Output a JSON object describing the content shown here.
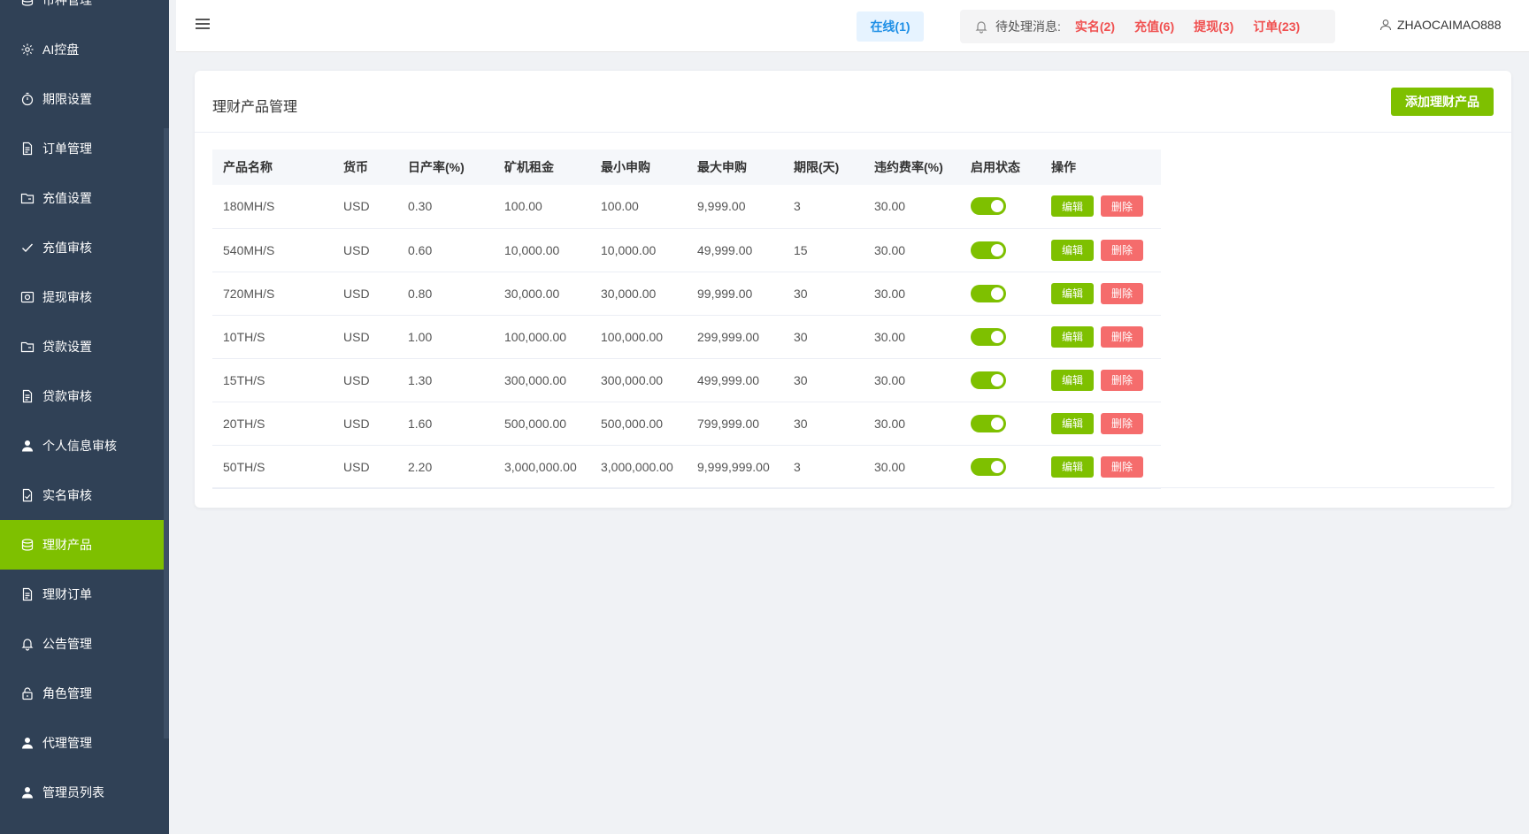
{
  "colors": {
    "sidebar_bg": "#304156",
    "accent_green": "#7ec000",
    "danger_red": "#f56c6c",
    "online_blue": "#1e8fe6"
  },
  "sidebar": {
    "items": [
      {
        "label": "币种管理",
        "icon": "coin-icon",
        "active": false
      },
      {
        "label": "AI控盘",
        "icon": "gear-icon",
        "active": false
      },
      {
        "label": "期限设置",
        "icon": "timer-icon",
        "active": false
      },
      {
        "label": "订单管理",
        "icon": "document-icon",
        "active": false
      },
      {
        "label": "充值设置",
        "icon": "folder-icon",
        "active": false
      },
      {
        "label": "充值审核",
        "icon": "check-icon",
        "active": false
      },
      {
        "label": "提现审核",
        "icon": "picture-icon",
        "active": false
      },
      {
        "label": "贷款设置",
        "icon": "folder-icon",
        "active": false
      },
      {
        "label": "贷款审核",
        "icon": "document-icon",
        "active": false
      },
      {
        "label": "个人信息审核",
        "icon": "user-icon",
        "active": false
      },
      {
        "label": "实名审核",
        "icon": "document-check-icon",
        "active": false
      },
      {
        "label": "理财产品",
        "icon": "coin-icon",
        "active": true
      },
      {
        "label": "理财订单",
        "icon": "document-icon",
        "active": false
      },
      {
        "label": "公告管理",
        "icon": "bell-icon",
        "active": false
      },
      {
        "label": "角色管理",
        "icon": "lock-icon",
        "active": false
      },
      {
        "label": "代理管理",
        "icon": "user-icon",
        "active": false
      },
      {
        "label": "管理员列表",
        "icon": "user-icon",
        "active": false
      }
    ]
  },
  "header": {
    "online": "在线(1)",
    "pending_label": "待处理消息:",
    "pending": [
      {
        "label": "实名(2)"
      },
      {
        "label": "充值(6)"
      },
      {
        "label": "提现(3)"
      },
      {
        "label": "订单(23)"
      }
    ],
    "username": "ZHAOCAIMAO888"
  },
  "card": {
    "title": "理财产品管理",
    "add_button": "添加理财产品"
  },
  "table": {
    "columns": [
      "产品名称",
      "货币",
      "日产率(%)",
      "矿机租金",
      "最小申购",
      "最大申购",
      "期限(天)",
      "违约费率(%)",
      "启用状态",
      "操作"
    ],
    "edit_label": "编辑",
    "delete_label": "删除",
    "rows": [
      {
        "name": "180MH/S",
        "currency": "USD",
        "rate": "0.30",
        "rent": "100.00",
        "min": "100.00",
        "max": "9,999.00",
        "days": "3",
        "penalty": "30.00",
        "enabled": true
      },
      {
        "name": "540MH/S",
        "currency": "USD",
        "rate": "0.60",
        "rent": "10,000.00",
        "min": "10,000.00",
        "max": "49,999.00",
        "days": "15",
        "penalty": "30.00",
        "enabled": true
      },
      {
        "name": "720MH/S",
        "currency": "USD",
        "rate": "0.80",
        "rent": "30,000.00",
        "min": "30,000.00",
        "max": "99,999.00",
        "days": "30",
        "penalty": "30.00",
        "enabled": true
      },
      {
        "name": "10TH/S",
        "currency": "USD",
        "rate": "1.00",
        "rent": "100,000.00",
        "min": "100,000.00",
        "max": "299,999.00",
        "days": "30",
        "penalty": "30.00",
        "enabled": true
      },
      {
        "name": "15TH/S",
        "currency": "USD",
        "rate": "1.30",
        "rent": "300,000.00",
        "min": "300,000.00",
        "max": "499,999.00",
        "days": "30",
        "penalty": "30.00",
        "enabled": true
      },
      {
        "name": "20TH/S",
        "currency": "USD",
        "rate": "1.60",
        "rent": "500,000.00",
        "min": "500,000.00",
        "max": "799,999.00",
        "days": "30",
        "penalty": "30.00",
        "enabled": true
      },
      {
        "name": "50TH/S",
        "currency": "USD",
        "rate": "2.20",
        "rent": "3,000,000.00",
        "min": "3,000,000.00",
        "max": "9,999,999.00",
        "days": "3",
        "penalty": "30.00",
        "enabled": true
      }
    ]
  }
}
